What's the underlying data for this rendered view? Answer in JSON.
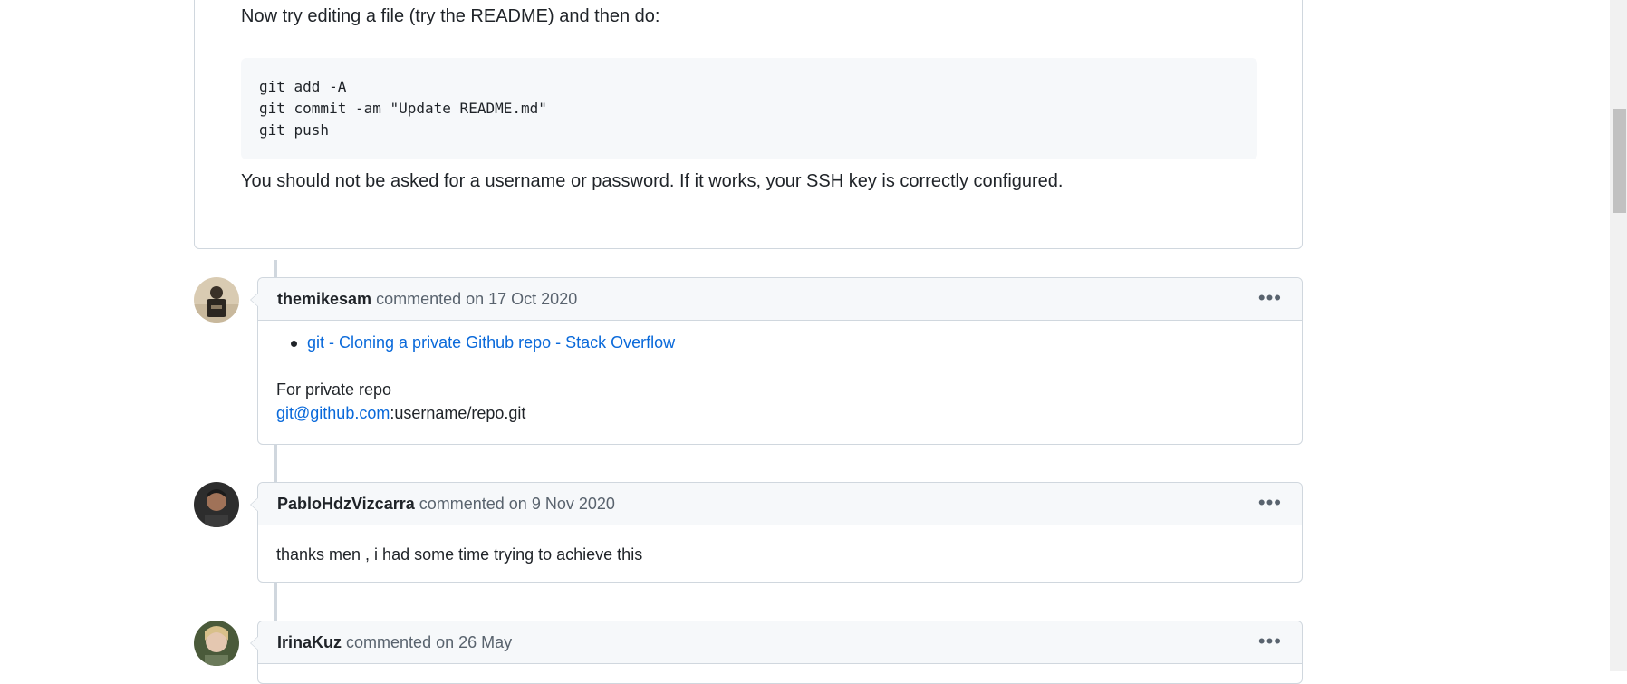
{
  "gist": {
    "intro": "Now try editing a file (try the README) and then do:",
    "code_lines": [
      "git add -A",
      "git commit -am \"Update README.md\"",
      "git push"
    ],
    "outro": "You should not be asked for a username or password. If it works, your SSH key is correctly configured."
  },
  "comments": [
    {
      "author": "themikesam",
      "meta": "commented on 17 Oct 2020",
      "link_text": "git - Cloning a private Github repo - Stack Overflow",
      "line1": "For private repo",
      "email_link": "git@github.com",
      "email_rest": ":username/repo.git"
    },
    {
      "author": "PabloHdzVizcarra",
      "meta": "commented on 9 Nov 2020",
      "text": "thanks men , i had some time trying to achieve this"
    },
    {
      "author": "IrinaKuz",
      "meta": "commented on 26 May"
    }
  ],
  "menu_icon": "kebab-horizontal-icon",
  "colors": {
    "border": "#d0d7de",
    "header_bg": "#f6f8fa",
    "link": "#0969da",
    "text": "#1f2328",
    "muted": "#59636e"
  }
}
